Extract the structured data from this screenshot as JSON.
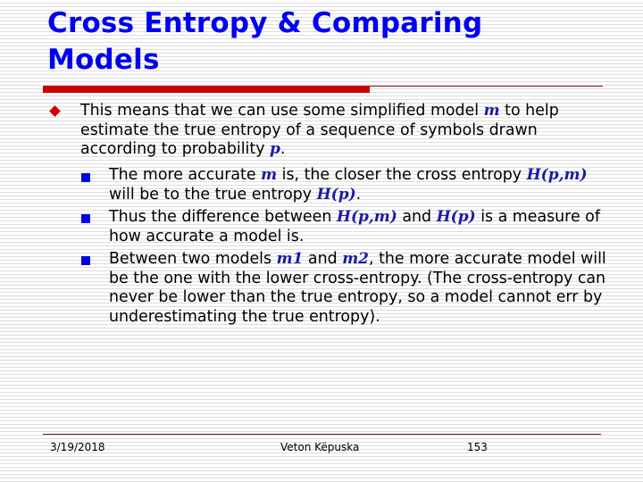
{
  "slide": {
    "title_line1": "Cross Entropy & Comparing",
    "title_line2": "Models",
    "bullets": [
      {
        "text_parts": [
          {
            "t": "This means that we can use some simplified model "
          },
          {
            "t": "m",
            "math": true
          },
          {
            "t": " to help estimate the true entropy of a sequence of symbols drawn according to probability "
          },
          {
            "t": "p",
            "math": true
          },
          {
            "t": "."
          }
        ],
        "sub_bullets": [
          {
            "text_parts": [
              {
                "t": "The more accurate "
              },
              {
                "t": "m",
                "math": true
              },
              {
                "t": " is, the closer the cross entropy "
              },
              {
                "t": "H(p,m)",
                "math": true
              },
              {
                "t": " will be to the true entropy "
              },
              {
                "t": "H(p)",
                "math": true
              },
              {
                "t": "."
              }
            ]
          },
          {
            "text_parts": [
              {
                "t": "Thus the difference between "
              },
              {
                "t": "H(p,m)",
                "math": true
              },
              {
                "t": " and "
              },
              {
                "t": "H(p)",
                "math": true
              },
              {
                "t": " is a measure of how accurate a model is."
              }
            ]
          },
          {
            "text_parts": [
              {
                "t": "Between two models "
              },
              {
                "t": "m1",
                "math": true
              },
              {
                "t": " and "
              },
              {
                "t": "m2",
                "math": true
              },
              {
                "t": ", the more accurate model will be the one with the lower cross-entropy. (The cross-entropy can never be lower than the true entropy, so a model cannot err by underestimating the true entropy)."
              }
            ]
          }
        ]
      }
    ],
    "bullet_icons": {
      "level1": "diamond-bullet-icon",
      "level2": "square-bullet-icon"
    },
    "colors": {
      "title": "#0000f0",
      "accent_bar": "#cc0000",
      "math": "#1a1aa6",
      "level2_bullet": "#0000ee"
    }
  },
  "footer": {
    "date": "3/19/2018",
    "author": "Veton Këpuska",
    "page_number": "153"
  }
}
